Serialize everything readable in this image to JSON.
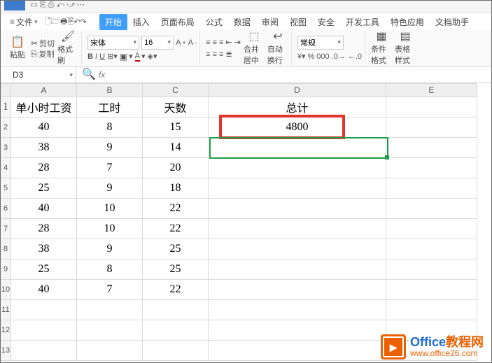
{
  "menu": {
    "file": "文件",
    "tabs": [
      "开始",
      "插入",
      "页面布局",
      "公式",
      "数据",
      "审阅",
      "视图",
      "安全",
      "开发工具",
      "特色应用",
      "文档助手"
    ]
  },
  "ribbon": {
    "paste": "粘贴",
    "cut": "剪切",
    "copy": "复制",
    "formatPainter": "格式刷",
    "fontName": "宋体",
    "fontSize": "16",
    "bold": "B",
    "italic": "I",
    "underline": "U",
    "mergeCenter": "合并居中",
    "wrapText": "自动换行",
    "numberFormat": "常规",
    "condFormat": "条件格式",
    "tableStyle": "表格样式"
  },
  "nameBox": "D3",
  "fx": "fx",
  "columns": [
    "A",
    "B",
    "C",
    "D",
    "E"
  ],
  "headers": {
    "A": "单小时工资",
    "B": "工时",
    "C": "天数",
    "D": "总计"
  },
  "rows": [
    {
      "n": "1",
      "A": "单小时工资",
      "B": "工时",
      "C": "天数",
      "D": "总计"
    },
    {
      "n": "2",
      "A": "40",
      "B": "8",
      "C": "15",
      "D": "4800"
    },
    {
      "n": "3",
      "A": "38",
      "B": "9",
      "C": "14",
      "D": ""
    },
    {
      "n": "4",
      "A": "28",
      "B": "7",
      "C": "20",
      "D": ""
    },
    {
      "n": "5",
      "A": "25",
      "B": "9",
      "C": "18",
      "D": ""
    },
    {
      "n": "6",
      "A": "40",
      "B": "10",
      "C": "22",
      "D": ""
    },
    {
      "n": "7",
      "A": "28",
      "B": "10",
      "C": "22",
      "D": ""
    },
    {
      "n": "8",
      "A": "38",
      "B": "9",
      "C": "25",
      "D": ""
    },
    {
      "n": "9",
      "A": "25",
      "B": "8",
      "C": "25",
      "D": ""
    },
    {
      "n": "10",
      "A": "40",
      "B": "7",
      "C": "22",
      "D": ""
    },
    {
      "n": "11",
      "A": "",
      "B": "",
      "C": "",
      "D": ""
    },
    {
      "n": "12",
      "A": "",
      "B": "",
      "C": "",
      "D": ""
    },
    {
      "n": "13",
      "A": "",
      "B": "",
      "C": "",
      "D": ""
    }
  ],
  "watermark": {
    "title1": "Office",
    "title2": "教程网",
    "url": "www.office26.com"
  }
}
